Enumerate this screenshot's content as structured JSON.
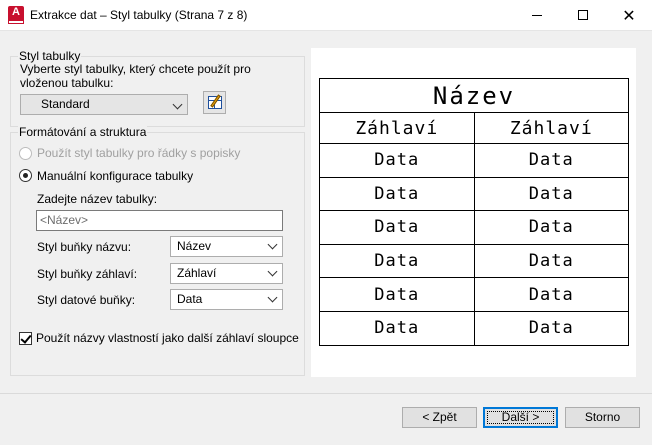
{
  "window": {
    "title": "Extrakce dat – Styl tabulky (Strana 7 z 8)",
    "app_icon_letter": "A"
  },
  "table_style": {
    "group_label": "Styl tabulky",
    "description": "Vyberte styl tabulky, který chcete použít pro vloženou tabulku:",
    "selected_style": "Standard"
  },
  "formatting": {
    "group_label": "Formátování a struktura",
    "radio_use_style": "Použít styl tabulky pro řádky s popisky",
    "radio_manual": "Manuální konfigurace tabulky",
    "name_label": "Zadejte název tabulky:",
    "name_placeholder": "<Název>",
    "title_cell_label": "Styl buňky názvu:",
    "title_cell_value": "Název",
    "header_cell_label": "Styl buňky záhlaví:",
    "header_cell_value": "Záhlaví",
    "data_cell_label": "Styl datové buňky:",
    "data_cell_value": "Data",
    "checkbox_label": "Použít názvy vlastností jako další záhlaví sloupce",
    "checkbox_checked": true
  },
  "preview": {
    "title": "Název",
    "headers": [
      "Záhlaví",
      "Záhlaví"
    ],
    "rows": [
      [
        "Data",
        "Data"
      ],
      [
        "Data",
        "Data"
      ],
      [
        "Data",
        "Data"
      ],
      [
        "Data",
        "Data"
      ],
      [
        "Data",
        "Data"
      ],
      [
        "Data",
        "Data"
      ]
    ]
  },
  "buttons": {
    "back": "< Zpět",
    "next": "Další >",
    "cancel": "Storno"
  }
}
